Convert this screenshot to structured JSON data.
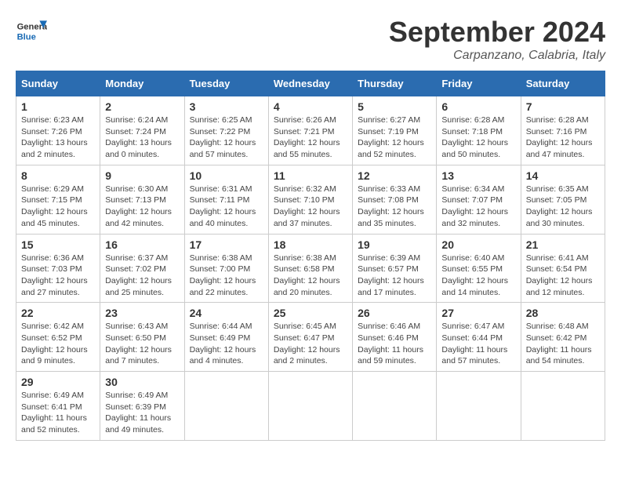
{
  "header": {
    "logo_general": "General",
    "logo_blue": "Blue",
    "month_title": "September 2024",
    "subtitle": "Carpanzano, Calabria, Italy"
  },
  "calendar": {
    "days_of_week": [
      "Sunday",
      "Monday",
      "Tuesday",
      "Wednesday",
      "Thursday",
      "Friday",
      "Saturday"
    ],
    "weeks": [
      [
        {
          "day": "1",
          "info": "Sunrise: 6:23 AM\nSunset: 7:26 PM\nDaylight: 13 hours\nand 2 minutes."
        },
        {
          "day": "2",
          "info": "Sunrise: 6:24 AM\nSunset: 7:24 PM\nDaylight: 13 hours\nand 0 minutes."
        },
        {
          "day": "3",
          "info": "Sunrise: 6:25 AM\nSunset: 7:22 PM\nDaylight: 12 hours\nand 57 minutes."
        },
        {
          "day": "4",
          "info": "Sunrise: 6:26 AM\nSunset: 7:21 PM\nDaylight: 12 hours\nand 55 minutes."
        },
        {
          "day": "5",
          "info": "Sunrise: 6:27 AM\nSunset: 7:19 PM\nDaylight: 12 hours\nand 52 minutes."
        },
        {
          "day": "6",
          "info": "Sunrise: 6:28 AM\nSunset: 7:18 PM\nDaylight: 12 hours\nand 50 minutes."
        },
        {
          "day": "7",
          "info": "Sunrise: 6:28 AM\nSunset: 7:16 PM\nDaylight: 12 hours\nand 47 minutes."
        }
      ],
      [
        {
          "day": "8",
          "info": "Sunrise: 6:29 AM\nSunset: 7:15 PM\nDaylight: 12 hours\nand 45 minutes."
        },
        {
          "day": "9",
          "info": "Sunrise: 6:30 AM\nSunset: 7:13 PM\nDaylight: 12 hours\nand 42 minutes."
        },
        {
          "day": "10",
          "info": "Sunrise: 6:31 AM\nSunset: 7:11 PM\nDaylight: 12 hours\nand 40 minutes."
        },
        {
          "day": "11",
          "info": "Sunrise: 6:32 AM\nSunset: 7:10 PM\nDaylight: 12 hours\nand 37 minutes."
        },
        {
          "day": "12",
          "info": "Sunrise: 6:33 AM\nSunset: 7:08 PM\nDaylight: 12 hours\nand 35 minutes."
        },
        {
          "day": "13",
          "info": "Sunrise: 6:34 AM\nSunset: 7:07 PM\nDaylight: 12 hours\nand 32 minutes."
        },
        {
          "day": "14",
          "info": "Sunrise: 6:35 AM\nSunset: 7:05 PM\nDaylight: 12 hours\nand 30 minutes."
        }
      ],
      [
        {
          "day": "15",
          "info": "Sunrise: 6:36 AM\nSunset: 7:03 PM\nDaylight: 12 hours\nand 27 minutes."
        },
        {
          "day": "16",
          "info": "Sunrise: 6:37 AM\nSunset: 7:02 PM\nDaylight: 12 hours\nand 25 minutes."
        },
        {
          "day": "17",
          "info": "Sunrise: 6:38 AM\nSunset: 7:00 PM\nDaylight: 12 hours\nand 22 minutes."
        },
        {
          "day": "18",
          "info": "Sunrise: 6:38 AM\nSunset: 6:58 PM\nDaylight: 12 hours\nand 20 minutes."
        },
        {
          "day": "19",
          "info": "Sunrise: 6:39 AM\nSunset: 6:57 PM\nDaylight: 12 hours\nand 17 minutes."
        },
        {
          "day": "20",
          "info": "Sunrise: 6:40 AM\nSunset: 6:55 PM\nDaylight: 12 hours\nand 14 minutes."
        },
        {
          "day": "21",
          "info": "Sunrise: 6:41 AM\nSunset: 6:54 PM\nDaylight: 12 hours\nand 12 minutes."
        }
      ],
      [
        {
          "day": "22",
          "info": "Sunrise: 6:42 AM\nSunset: 6:52 PM\nDaylight: 12 hours\nand 9 minutes."
        },
        {
          "day": "23",
          "info": "Sunrise: 6:43 AM\nSunset: 6:50 PM\nDaylight: 12 hours\nand 7 minutes."
        },
        {
          "day": "24",
          "info": "Sunrise: 6:44 AM\nSunset: 6:49 PM\nDaylight: 12 hours\nand 4 minutes."
        },
        {
          "day": "25",
          "info": "Sunrise: 6:45 AM\nSunset: 6:47 PM\nDaylight: 12 hours\nand 2 minutes."
        },
        {
          "day": "26",
          "info": "Sunrise: 6:46 AM\nSunset: 6:46 PM\nDaylight: 11 hours\nand 59 minutes."
        },
        {
          "day": "27",
          "info": "Sunrise: 6:47 AM\nSunset: 6:44 PM\nDaylight: 11 hours\nand 57 minutes."
        },
        {
          "day": "28",
          "info": "Sunrise: 6:48 AM\nSunset: 6:42 PM\nDaylight: 11 hours\nand 54 minutes."
        }
      ],
      [
        {
          "day": "29",
          "info": "Sunrise: 6:49 AM\nSunset: 6:41 PM\nDaylight: 11 hours\nand 52 minutes."
        },
        {
          "day": "30",
          "info": "Sunrise: 6:49 AM\nSunset: 6:39 PM\nDaylight: 11 hours\nand 49 minutes."
        },
        {
          "day": "",
          "info": ""
        },
        {
          "day": "",
          "info": ""
        },
        {
          "day": "",
          "info": ""
        },
        {
          "day": "",
          "info": ""
        },
        {
          "day": "",
          "info": ""
        }
      ]
    ]
  }
}
